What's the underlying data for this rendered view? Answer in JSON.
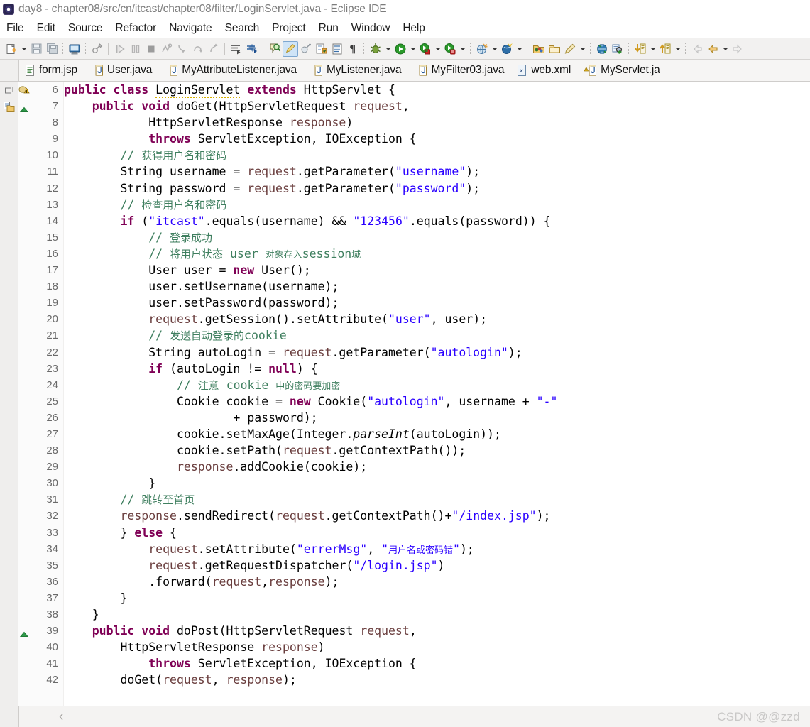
{
  "window": {
    "title": "day8 - chapter08/src/cn/itcast/chapter08/filter/LoginServlet.java - Eclipse IDE",
    "app_icon": "eclipse-icon"
  },
  "menubar": {
    "items": [
      {
        "label": "File"
      },
      {
        "label": "Edit"
      },
      {
        "label": "Source"
      },
      {
        "label": "Refactor"
      },
      {
        "label": "Navigate"
      },
      {
        "label": "Search"
      },
      {
        "label": "Project"
      },
      {
        "label": "Run"
      },
      {
        "label": "Window"
      },
      {
        "label": "Help"
      }
    ]
  },
  "toolbar": {
    "groups": [
      {
        "icons": [
          "new-file-icon",
          "dropdown-arrow",
          "save-icon",
          "save-all-icon",
          "sep",
          "console-icon",
          "sep",
          "toggle-breakpoint-icon",
          "sep-solid",
          "resume-icon",
          "suspend-icon",
          "terminate-icon",
          "disconnect-icon",
          "step-into-icon",
          "step-over-icon",
          "step-return-icon",
          "sep-solid",
          "open-declaration-icon",
          "build-icon",
          "sep",
          "search-icon",
          "annotation-icon",
          "marker-icon",
          "open-type-icon",
          "open-task-icon",
          "show-whitespace-icon",
          "sep",
          "debug-icon",
          "dropdown-arrow",
          "run-icon",
          "dropdown-arrow",
          "run-as-icon",
          "dropdown-arrow",
          "coverage-icon",
          "dropdown-arrow",
          "sep",
          "external-tools-icon",
          "dropdown-arrow",
          "server-icon",
          "dropdown-arrow",
          "sep",
          "open-folder-icon",
          "close-folder-icon",
          "pencil-icon",
          "dropdown-arrow",
          "sep",
          "web-browser-icon",
          "search-ref-icon",
          "sep",
          "next-annotation-icon",
          "dropdown-arrow",
          "prev-annotation-icon",
          "dropdown-arrow",
          "sep",
          "back-history-icon",
          "back-icon",
          "dropdown-arrow",
          "forward-icon"
        ]
      }
    ]
  },
  "tabs": {
    "items": [
      {
        "label": "form.jsp",
        "icon": "jsp-file-icon",
        "active": false,
        "warning": false
      },
      {
        "label": "User.java",
        "icon": "java-file-icon",
        "active": false,
        "warning": false
      },
      {
        "label": "MyAttributeListener.java",
        "icon": "java-file-icon",
        "active": false,
        "warning": false
      },
      {
        "label": "MyListener.java",
        "icon": "java-file-icon",
        "active": false,
        "warning": false
      },
      {
        "label": "MyFilter03.java",
        "icon": "java-file-icon",
        "active": false,
        "warning": false
      },
      {
        "label": "web.xml",
        "icon": "xml-file-icon",
        "active": false,
        "warning": false
      },
      {
        "label": "MyServlet.ja",
        "icon": "java-file-icon",
        "active": false,
        "warning": true
      }
    ]
  },
  "left_rail": {
    "icons": [
      "restore-view-icon",
      "package-explorer-icon"
    ]
  },
  "editor": {
    "language": "java",
    "first_line": 6,
    "lines": [
      {
        "n": 6,
        "marker": "warning-marker",
        "fold": "",
        "tokens": [
          {
            "t": "public",
            "c": "kw"
          },
          {
            "t": " ",
            "c": "pln"
          },
          {
            "t": "class",
            "c": "kw"
          },
          {
            "t": " ",
            "c": "pln"
          },
          {
            "t": "LoginServlet",
            "c": "pln warnu"
          },
          {
            "t": " ",
            "c": "pln"
          },
          {
            "t": "extends",
            "c": "kw"
          },
          {
            "t": " HttpServlet {",
            "c": "pln"
          }
        ]
      },
      {
        "n": 7,
        "marker": "fold-up-marker",
        "fold": "collapse",
        "tokens": [
          {
            "t": "    ",
            "c": "pln"
          },
          {
            "t": "public",
            "c": "kw"
          },
          {
            "t": " ",
            "c": "pln"
          },
          {
            "t": "void",
            "c": "kw"
          },
          {
            "t": " doGet(HttpServletRequest ",
            "c": "pln"
          },
          {
            "t": "request",
            "c": "fld"
          },
          {
            "t": ",",
            "c": "pln"
          }
        ]
      },
      {
        "n": 8,
        "marker": "",
        "fold": "",
        "tokens": [
          {
            "t": "            HttpServletResponse ",
            "c": "pln"
          },
          {
            "t": "response",
            "c": "fld"
          },
          {
            "t": ")",
            "c": "pln"
          }
        ]
      },
      {
        "n": 9,
        "marker": "",
        "fold": "",
        "tokens": [
          {
            "t": "            ",
            "c": "pln"
          },
          {
            "t": "throws",
            "c": "kw"
          },
          {
            "t": " ServletException, IOException {",
            "c": "pln"
          }
        ]
      },
      {
        "n": 10,
        "marker": "",
        "fold": "",
        "tokens": [
          {
            "t": "        ",
            "c": "pln"
          },
          {
            "t": "// ",
            "c": "cmt"
          },
          {
            "t": "获得用户名和密码",
            "c": "cmt cn"
          }
        ]
      },
      {
        "n": 11,
        "marker": "",
        "fold": "",
        "tokens": [
          {
            "t": "        String username = ",
            "c": "pln"
          },
          {
            "t": "request",
            "c": "fld"
          },
          {
            "t": ".getParameter(",
            "c": "pln"
          },
          {
            "t": "\"username\"",
            "c": "str"
          },
          {
            "t": ");",
            "c": "pln"
          }
        ]
      },
      {
        "n": 12,
        "marker": "",
        "fold": "",
        "tokens": [
          {
            "t": "        String password = ",
            "c": "pln"
          },
          {
            "t": "request",
            "c": "fld"
          },
          {
            "t": ".getParameter(",
            "c": "pln"
          },
          {
            "t": "\"password\"",
            "c": "str"
          },
          {
            "t": ");",
            "c": "pln"
          }
        ]
      },
      {
        "n": 13,
        "marker": "",
        "fold": "",
        "tokens": [
          {
            "t": "        ",
            "c": "pln"
          },
          {
            "t": "// ",
            "c": "cmt"
          },
          {
            "t": "检查用户名和密码",
            "c": "cmt cn"
          }
        ]
      },
      {
        "n": 14,
        "marker": "",
        "fold": "",
        "tokens": [
          {
            "t": "        ",
            "c": "pln"
          },
          {
            "t": "if",
            "c": "kw"
          },
          {
            "t": " (",
            "c": "pln"
          },
          {
            "t": "\"itcast\"",
            "c": "str"
          },
          {
            "t": ".equals(username) && ",
            "c": "pln"
          },
          {
            "t": "\"123456\"",
            "c": "str"
          },
          {
            "t": ".equals(password)) {",
            "c": "pln"
          }
        ]
      },
      {
        "n": 15,
        "marker": "",
        "fold": "",
        "tokens": [
          {
            "t": "            ",
            "c": "pln"
          },
          {
            "t": "// ",
            "c": "cmt"
          },
          {
            "t": "登录成功",
            "c": "cmt cn"
          }
        ]
      },
      {
        "n": 16,
        "marker": "",
        "fold": "",
        "tokens": [
          {
            "t": "            ",
            "c": "pln"
          },
          {
            "t": "// ",
            "c": "cmt"
          },
          {
            "t": "将用户状态",
            "c": "cmt cn"
          },
          {
            "t": " user ",
            "c": "cmt"
          },
          {
            "t": "对象存入",
            "c": "cmt cnsm"
          },
          {
            "t": "session",
            "c": "cmt"
          },
          {
            "t": "域",
            "c": "cmt cnsm"
          }
        ]
      },
      {
        "n": 17,
        "marker": "",
        "fold": "",
        "tokens": [
          {
            "t": "            User user = ",
            "c": "pln"
          },
          {
            "t": "new",
            "c": "kw"
          },
          {
            "t": " User();",
            "c": "pln"
          }
        ]
      },
      {
        "n": 18,
        "marker": "",
        "fold": "",
        "tokens": [
          {
            "t": "            user.setUsername(username);",
            "c": "pln"
          }
        ]
      },
      {
        "n": 19,
        "marker": "",
        "fold": "",
        "tokens": [
          {
            "t": "            user.setPassword(password);",
            "c": "pln"
          }
        ]
      },
      {
        "n": 20,
        "marker": "",
        "fold": "",
        "tokens": [
          {
            "t": "            ",
            "c": "pln"
          },
          {
            "t": "request",
            "c": "fld"
          },
          {
            "t": ".getSession().setAttribute(",
            "c": "pln"
          },
          {
            "t": "\"user\"",
            "c": "str"
          },
          {
            "t": ", user);",
            "c": "pln"
          }
        ]
      },
      {
        "n": 21,
        "marker": "",
        "fold": "",
        "tokens": [
          {
            "t": "            ",
            "c": "pln"
          },
          {
            "t": "// ",
            "c": "cmt"
          },
          {
            "t": "发送自动登录的",
            "c": "cmt cn"
          },
          {
            "t": "cookie",
            "c": "cmt"
          }
        ]
      },
      {
        "n": 22,
        "marker": "",
        "fold": "",
        "tokens": [
          {
            "t": "            String autoLogin = ",
            "c": "pln"
          },
          {
            "t": "request",
            "c": "fld"
          },
          {
            "t": ".getParameter(",
            "c": "pln"
          },
          {
            "t": "\"autologin\"",
            "c": "str"
          },
          {
            "t": ");",
            "c": "pln"
          }
        ]
      },
      {
        "n": 23,
        "marker": "",
        "fold": "",
        "tokens": [
          {
            "t": "            ",
            "c": "pln"
          },
          {
            "t": "if",
            "c": "kw"
          },
          {
            "t": " (autoLogin != ",
            "c": "pln"
          },
          {
            "t": "null",
            "c": "kw"
          },
          {
            "t": ") {",
            "c": "pln"
          }
        ]
      },
      {
        "n": 24,
        "marker": "",
        "fold": "",
        "tokens": [
          {
            "t": "                ",
            "c": "pln"
          },
          {
            "t": "// ",
            "c": "cmt"
          },
          {
            "t": "注意",
            "c": "cmt cn"
          },
          {
            "t": " cookie ",
            "c": "cmt"
          },
          {
            "t": "中的密码要加密",
            "c": "cmt cnsm"
          }
        ]
      },
      {
        "n": 25,
        "marker": "",
        "fold": "",
        "tokens": [
          {
            "t": "                Cookie cookie = ",
            "c": "pln"
          },
          {
            "t": "new",
            "c": "kw"
          },
          {
            "t": " Cookie(",
            "c": "pln"
          },
          {
            "t": "\"autologin\"",
            "c": "str"
          },
          {
            "t": ", username + ",
            "c": "pln"
          },
          {
            "t": "\"-\"",
            "c": "str"
          }
        ]
      },
      {
        "n": 26,
        "marker": "",
        "fold": "",
        "tokens": [
          {
            "t": "                        + password);",
            "c": "pln"
          }
        ]
      },
      {
        "n": 27,
        "marker": "",
        "fold": "",
        "tokens": [
          {
            "t": "                cookie.setMaxAge(Integer.",
            "c": "pln"
          },
          {
            "t": "parseInt",
            "c": "stat"
          },
          {
            "t": "(autoLogin));",
            "c": "pln"
          }
        ]
      },
      {
        "n": 28,
        "marker": "",
        "fold": "",
        "tokens": [
          {
            "t": "                cookie.setPath(",
            "c": "pln"
          },
          {
            "t": "request",
            "c": "fld"
          },
          {
            "t": ".getContextPath());",
            "c": "pln"
          }
        ]
      },
      {
        "n": 29,
        "marker": "",
        "fold": "",
        "tokens": [
          {
            "t": "                ",
            "c": "pln"
          },
          {
            "t": "response",
            "c": "fld"
          },
          {
            "t": ".addCookie(cookie);",
            "c": "pln"
          }
        ]
      },
      {
        "n": 30,
        "marker": "",
        "fold": "",
        "tokens": [
          {
            "t": "            }",
            "c": "pln"
          }
        ]
      },
      {
        "n": 31,
        "marker": "",
        "fold": "",
        "tokens": [
          {
            "t": "        ",
            "c": "pln"
          },
          {
            "t": "// ",
            "c": "cmt"
          },
          {
            "t": "跳转至首页",
            "c": "cmt cn"
          }
        ]
      },
      {
        "n": 32,
        "marker": "",
        "fold": "",
        "tokens": [
          {
            "t": "        ",
            "c": "pln"
          },
          {
            "t": "response",
            "c": "fld"
          },
          {
            "t": ".sendRedirect(",
            "c": "pln"
          },
          {
            "t": "request",
            "c": "fld"
          },
          {
            "t": ".getContextPath()+",
            "c": "pln"
          },
          {
            "t": "\"/index.jsp\"",
            "c": "str"
          },
          {
            "t": ");",
            "c": "pln"
          }
        ]
      },
      {
        "n": 33,
        "marker": "",
        "fold": "",
        "tokens": [
          {
            "t": "        } ",
            "c": "pln"
          },
          {
            "t": "else",
            "c": "kw"
          },
          {
            "t": " {",
            "c": "pln"
          }
        ]
      },
      {
        "n": 34,
        "marker": "",
        "fold": "",
        "tokens": [
          {
            "t": "            ",
            "c": "pln"
          },
          {
            "t": "request",
            "c": "fld"
          },
          {
            "t": ".setAttribute(",
            "c": "pln"
          },
          {
            "t": "\"errerMsg\"",
            "c": "str"
          },
          {
            "t": ", ",
            "c": "pln"
          },
          {
            "t": "\"",
            "c": "str"
          },
          {
            "t": "用户名或密码错",
            "c": "str cnsm"
          },
          {
            "t": "\"",
            "c": "str"
          },
          {
            "t": ");",
            "c": "pln"
          }
        ]
      },
      {
        "n": 35,
        "marker": "",
        "fold": "",
        "tokens": [
          {
            "t": "            ",
            "c": "pln"
          },
          {
            "t": "request",
            "c": "fld"
          },
          {
            "t": ".getRequestDispatcher(",
            "c": "pln"
          },
          {
            "t": "\"/login.jsp\"",
            "c": "str"
          },
          {
            "t": ")",
            "c": "pln"
          }
        ]
      },
      {
        "n": 36,
        "marker": "",
        "fold": "",
        "tokens": [
          {
            "t": "            .forward(",
            "c": "pln"
          },
          {
            "t": "request",
            "c": "fld"
          },
          {
            "t": ",",
            "c": "pln"
          },
          {
            "t": "response",
            "c": "fld"
          },
          {
            "t": ");",
            "c": "pln"
          }
        ]
      },
      {
        "n": 37,
        "marker": "",
        "fold": "",
        "tokens": [
          {
            "t": "        }",
            "c": "pln"
          }
        ]
      },
      {
        "n": 38,
        "marker": "",
        "fold": "",
        "tokens": [
          {
            "t": "    }",
            "c": "pln"
          }
        ]
      },
      {
        "n": 39,
        "marker": "fold-up-marker",
        "fold": "collapse",
        "tokens": [
          {
            "t": "    ",
            "c": "pln"
          },
          {
            "t": "public",
            "c": "kw"
          },
          {
            "t": " ",
            "c": "pln"
          },
          {
            "t": "void",
            "c": "kw"
          },
          {
            "t": " doPost(HttpServletRequest ",
            "c": "pln"
          },
          {
            "t": "request",
            "c": "fld"
          },
          {
            "t": ",",
            "c": "pln"
          }
        ]
      },
      {
        "n": 40,
        "marker": "",
        "fold": "",
        "tokens": [
          {
            "t": "        HttpServletResponse ",
            "c": "pln"
          },
          {
            "t": "response",
            "c": "fld"
          },
          {
            "t": ")",
            "c": "pln"
          }
        ]
      },
      {
        "n": 41,
        "marker": "",
        "fold": "",
        "tokens": [
          {
            "t": "            ",
            "c": "pln"
          },
          {
            "t": "throws",
            "c": "kw"
          },
          {
            "t": " ServletException, IOException {",
            "c": "pln"
          }
        ]
      },
      {
        "n": 42,
        "marker": "",
        "fold": "",
        "tokens": [
          {
            "t": "        doGet(",
            "c": "pln"
          },
          {
            "t": "request",
            "c": "fld"
          },
          {
            "t": ", ",
            "c": "pln"
          },
          {
            "t": "response",
            "c": "fld"
          },
          {
            "t": ");",
            "c": "pln"
          }
        ]
      }
    ]
  },
  "bottombar": {
    "chevron": "‹",
    "watermark": "CSDN @@zzd"
  },
  "colors": {
    "keyword": "#7f0055",
    "string": "#2a00ff",
    "comment": "#3f7f5f",
    "field": "#6a3e3e",
    "plain": "#000000",
    "toolbar_bg": "#f2f1f0",
    "gutter_bg": "#fbfbfb",
    "editor_bg": "#ffffff",
    "warning_underline": "#d6b000"
  }
}
